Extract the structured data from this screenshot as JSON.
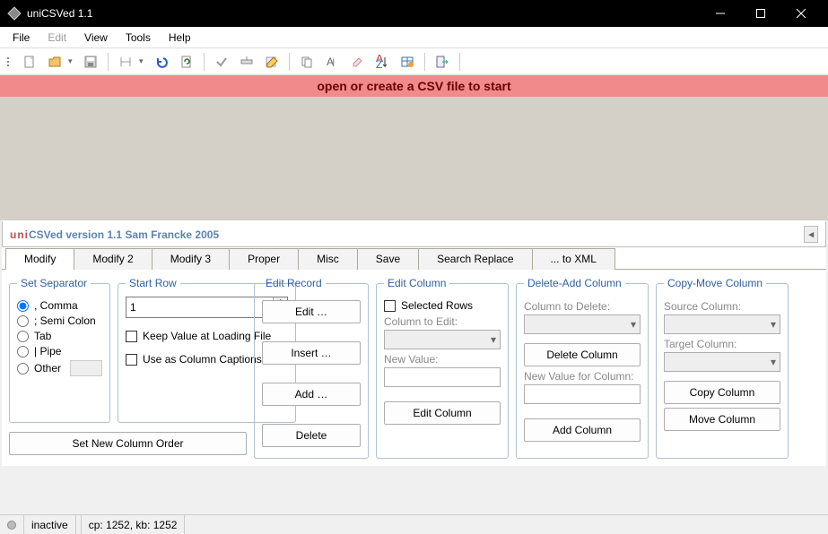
{
  "window": {
    "title": "uniCSVed 1.1"
  },
  "menu": {
    "file": "File",
    "edit": "Edit",
    "view": "View",
    "tools": "Tools",
    "help": "Help"
  },
  "banner": "open  or create a CSV file to start",
  "appstrip": {
    "uni": "uni",
    "rest": "CSVed  version 1.1 Sam Francke 2005"
  },
  "tabs": [
    "Modify",
    "Modify 2",
    "Modify 3",
    "Proper",
    "Misc",
    "Save",
    "Search Replace",
    "... to XML"
  ],
  "separator": {
    "legend": "Set Separator",
    "comma": ", Comma",
    "semi": "; Semi Colon",
    "tab": "Tab",
    "pipe": "| Pipe",
    "other": "Other",
    "orderBtn": "Set New Column Order"
  },
  "startrow": {
    "legend": "Start Row",
    "value": "1",
    "keep": "Keep Value at Loading File",
    "captions": "Use as Column Captions"
  },
  "editrec": {
    "legend": "Edit Record",
    "edit": "Edit …",
    "insert": "Insert …",
    "add": "Add …",
    "delete": "Delete"
  },
  "editcol": {
    "legend": "Edit Column",
    "selected": "Selected Rows",
    "coltoedit": "Column to Edit:",
    "newval": "New Value:",
    "btn": "Edit Column"
  },
  "delcol": {
    "legend": "Delete-Add Column",
    "coltodel": "Column to Delete:",
    "delbtn": "Delete Column",
    "newval": "New Value for Column:",
    "addbtn": "Add Column"
  },
  "copycol": {
    "legend": "Copy-Move  Column",
    "src": "Source Column:",
    "tgt": "Target Column:",
    "copy": "Copy Column",
    "move": "Move Column"
  },
  "status": {
    "inactive": "inactive",
    "cp": "cp: 1252, kb: 1252"
  }
}
